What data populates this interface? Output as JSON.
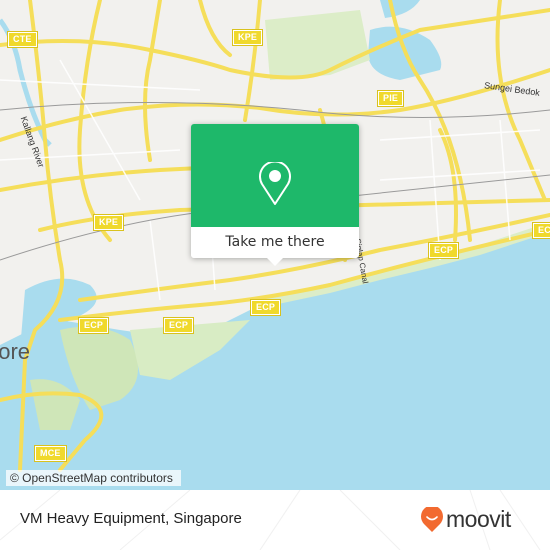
{
  "map": {
    "colors": {
      "land": "#f2f1ee",
      "water": "#a9dcee",
      "road": "#f5de5a",
      "park": "#cfe6b8",
      "popup_green": "#1eb86a",
      "moovit_orange": "#f26a30"
    },
    "road_shields": [
      {
        "label": "CTE"
      },
      {
        "label": "KPE"
      },
      {
        "label": "PIE"
      },
      {
        "label": "KPE"
      },
      {
        "label": "ECP"
      },
      {
        "label": "ECP"
      },
      {
        "label": "ECP"
      },
      {
        "label": "ECP"
      },
      {
        "label": "ECP"
      },
      {
        "label": "MCE"
      }
    ],
    "labels": {
      "kallang_river": "Kallang River",
      "sungei_bedok": "Sungei Bedok",
      "siglap_canal": "Siglap Canal",
      "city_fragment": "pore"
    },
    "attribution": "© OpenStreetMap contributors"
  },
  "popup": {
    "icon": "map-pin-icon",
    "button_label": "Take me there"
  },
  "footer": {
    "place_name": "VM Heavy Equipment, Singapore",
    "brand": "moovit",
    "brand_icon": "moovit-smile-pin-icon"
  }
}
